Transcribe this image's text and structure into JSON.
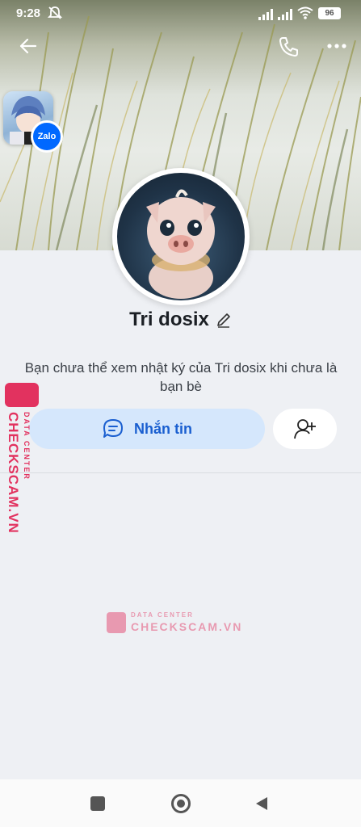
{
  "status_bar": {
    "time": "9:28",
    "battery": "96"
  },
  "profile": {
    "name": "Tri dosix",
    "notice": "Bạn chưa thể xem nhật ký của Tri dosix khi chưa là bạn bè",
    "zalo_badge": "Zalo"
  },
  "actions": {
    "message_label": "Nhắn tin"
  },
  "watermark": {
    "brand": "CHECKSCAM.VN",
    "sub": "DATA CENTER"
  },
  "icons": {
    "back": "arrow-left-icon",
    "call": "phone-icon",
    "more": "more-horizontal-icon",
    "edit": "pencil-icon",
    "message": "chat-bubble-icon",
    "add_friend": "user-plus-icon"
  },
  "colors": {
    "accent": "#1a5fd0",
    "message_button_bg": "#d5e7fc",
    "watermark": "#e2325f",
    "zalo_blue": "#0068ff"
  }
}
